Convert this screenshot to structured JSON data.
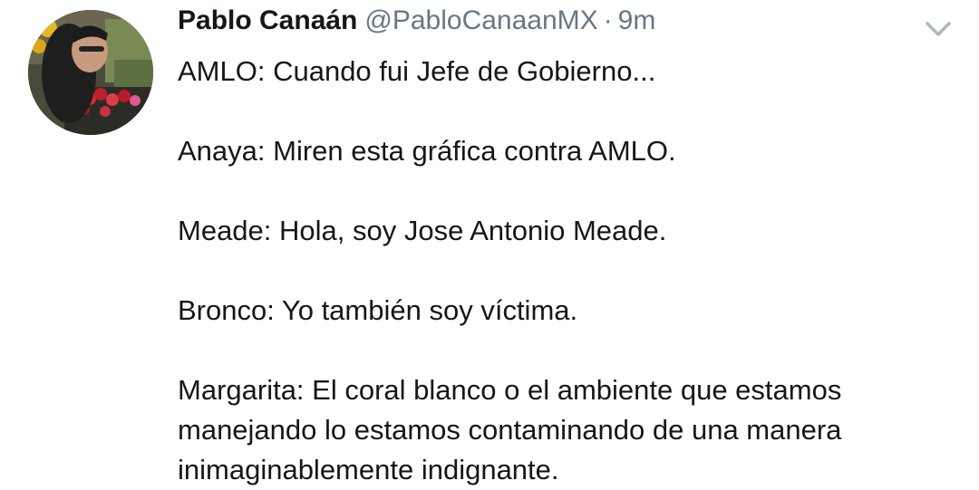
{
  "tweet": {
    "author_name": "Pablo Canaán",
    "handle": "@PabloCanaanMX",
    "separator": "·",
    "time": "9m",
    "lines": [
      "AMLO: Cuando fui Jefe de Gobierno...",
      "",
      "Anaya: Miren esta gráfica contra AMLO.",
      "",
      "Meade: Hola, soy Jose Antonio Meade.",
      "",
      "Bronco: Yo también soy víctima.",
      "",
      "Margarita: El coral blanco o el ambiente que estamos",
      "manejando lo estamos contaminando de una manera",
      "inimaginablemente indignante."
    ]
  },
  "icons": {
    "menu": "chevron-down-icon"
  },
  "colors": {
    "text": "#14171a",
    "secondary": "#657786",
    "chevron": "#aab8c2"
  }
}
